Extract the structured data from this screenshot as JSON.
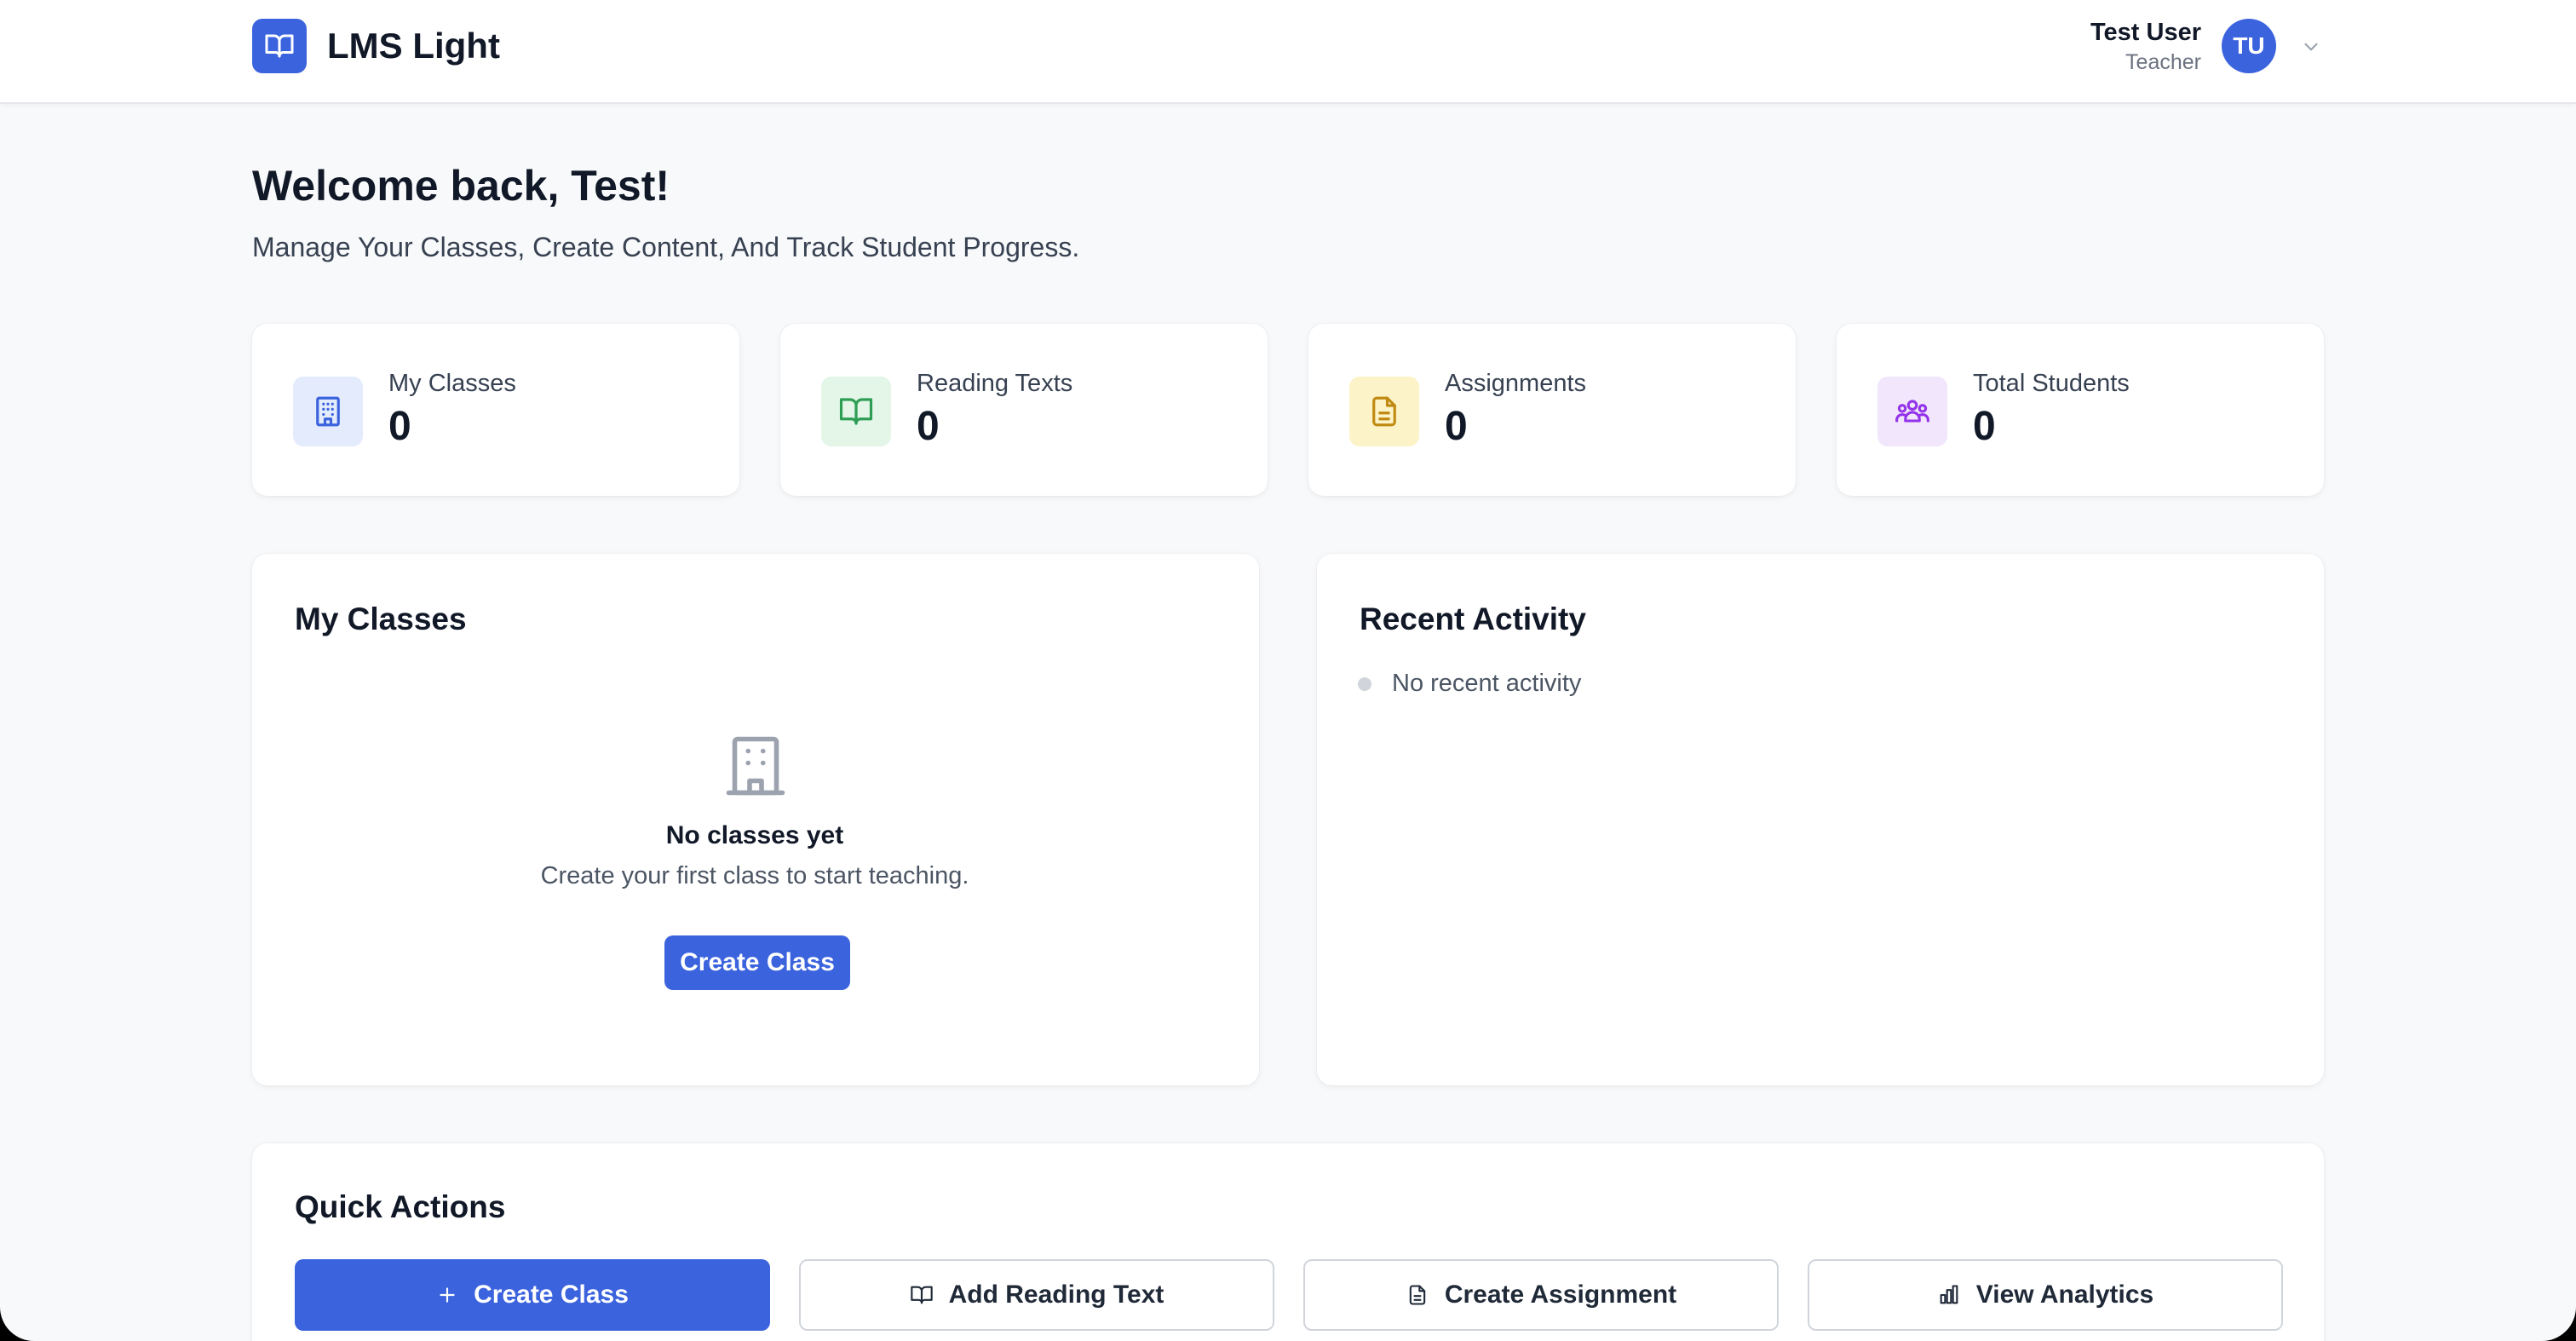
{
  "header": {
    "app_title": "LMS Light",
    "logo_icon": "book-open-icon",
    "user_name": "Test User",
    "user_role": "Teacher",
    "avatar_initials": "TU",
    "menu_icon": "chevron-down-icon"
  },
  "welcome": {
    "title": "Welcome back, Test!",
    "subtitle": "Manage Your Classes, Create Content, And Track Student Progress."
  },
  "stats": [
    {
      "label": "My Classes",
      "value": "0",
      "icon": "building-icon",
      "bg": "#e3ebfc",
      "color": "#3b63dd"
    },
    {
      "label": "Reading Texts",
      "value": "0",
      "icon": "book-open-icon",
      "bg": "#e3f6e8",
      "color": "#2f9e55"
    },
    {
      "label": "Assignments",
      "value": "0",
      "icon": "document-icon",
      "bg": "#fdf3c8",
      "color": "#c08a12"
    },
    {
      "label": "Total Students",
      "value": "0",
      "icon": "users-group-icon",
      "bg": "#f1e6fb",
      "color": "#9333ea"
    }
  ],
  "classes_panel": {
    "title": "My Classes",
    "empty_icon": "building-icon",
    "empty_title": "No classes yet",
    "empty_text": "Create your first class to start teaching.",
    "button_label": "Create Class"
  },
  "activity_panel": {
    "title": "Recent Activity",
    "items": [
      "No recent activity"
    ]
  },
  "quick_actions": {
    "title": "Quick Actions",
    "buttons": [
      {
        "label": "Create Class",
        "icon": "plus-icon",
        "style": "primary"
      },
      {
        "label": "Add Reading Text",
        "icon": "book-open-icon",
        "style": "outline"
      },
      {
        "label": "Create Assignment",
        "icon": "document-icon",
        "style": "outline"
      },
      {
        "label": "View Analytics",
        "icon": "bar-chart-icon",
        "style": "outline"
      }
    ]
  },
  "colors": {
    "accent": "#3b63dd",
    "background": "#f8f9fb"
  }
}
